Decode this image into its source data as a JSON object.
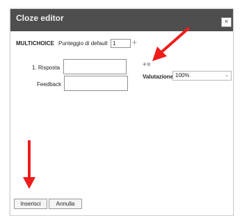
{
  "dialog": {
    "title": "Cloze editor",
    "close_glyph": "×",
    "type_label": "MULTICHOICE",
    "default_score_label": "Punteggio di default",
    "default_score_value": "1",
    "add_icon_glyph": "+",
    "answer": {
      "label": "1. Risposta",
      "value": "",
      "feedback_label": "Feedback",
      "feedback_value": "",
      "actions_glyph": "+×",
      "grade_label": "Valutazione",
      "grade_value": "100%"
    },
    "buttons": {
      "insert": "Inserisci",
      "cancel": "Annulla"
    }
  },
  "annotation": {
    "arrow_color": "#ee1c1c"
  }
}
